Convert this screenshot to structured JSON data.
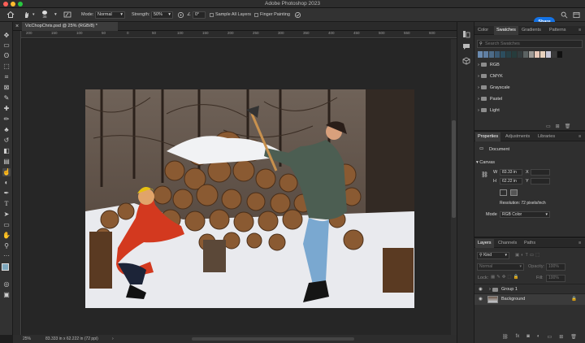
{
  "window": {
    "title": "Adobe Photoshop 2023"
  },
  "options_bar": {
    "brush_size": "35",
    "mode_label": "Mode:",
    "mode_value": "Normal",
    "strength_label": "Strength:",
    "strength_value": "50%",
    "angle_symbol": "∠",
    "angle_value": "0°",
    "sample_all_layers": "Sample All Layers",
    "finger_painting": "Finger Painting",
    "share": "Share"
  },
  "document": {
    "tab_title": "VicChopChris.psd @ 25% (RGB/8) *",
    "close_symbol": "×",
    "zoom": "25%",
    "status": "83.333 in x 62.222 in (72 ppi)"
  },
  "ruler": {
    "labels": [
      "200",
      "150",
      "100",
      "50",
      "0",
      "50",
      "100",
      "150",
      "200",
      "250",
      "300",
      "350",
      "400",
      "450",
      "500",
      "550",
      "600"
    ]
  },
  "swatches_panel": {
    "tabs": [
      "Color",
      "Swatches",
      "Gradients",
      "Patterns"
    ],
    "active_tab": "Swatches",
    "search_placeholder": "Search Swatches",
    "recent_colors": [
      "#6a8bb0",
      "#5f7fa3",
      "#4d6b88",
      "#3b5a74",
      "#2c4d5e",
      "#274046",
      "#263c3c",
      "#333c3e",
      "#5b6262",
      "#9d9a96",
      "#e8c8b8",
      "#e7d1bd",
      "#c8c8d8",
      "#3a3a3a",
      "#111111"
    ],
    "groups": [
      "RGB",
      "CMYK",
      "Grayscale",
      "Pastel",
      "Light"
    ]
  },
  "properties_panel": {
    "tabs": [
      "Properties",
      "Adjustments",
      "Libraries"
    ],
    "active_tab": "Properties",
    "type_label": "Document",
    "section": "Canvas",
    "w_label": "W",
    "w_value": "83.33 in",
    "h_label": "H",
    "h_value": "62.22 in",
    "x_label": "X",
    "y_label": "Y",
    "resolution": "Resolution: 72 pixels/inch",
    "mode_label": "Mode",
    "mode_value": "RGB Color"
  },
  "layers_panel": {
    "tabs": [
      "Layers",
      "Channels",
      "Paths"
    ],
    "active_tab": "Layers",
    "filter_kind": "Kind",
    "blend_mode": "Normal",
    "opacity_label": "Opacity:",
    "opacity_value": "100%",
    "lock_label": "Lock:",
    "fill_label": "Fill:",
    "fill_value": "100%",
    "layers": [
      {
        "name": "Group 1",
        "type": "group"
      },
      {
        "name": "Background",
        "type": "image",
        "locked": true
      }
    ]
  }
}
